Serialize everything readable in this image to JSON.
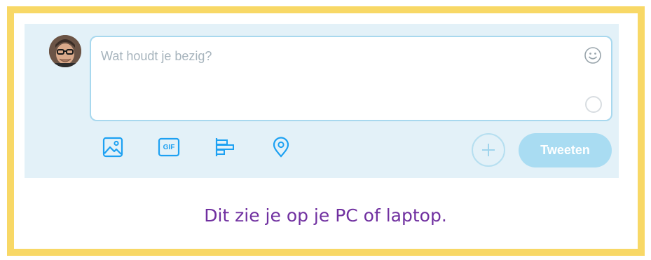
{
  "composer": {
    "placeholder": "Wat houdt je bezig?",
    "tweet_label": "Tweeten",
    "avatar_icon": "user-avatar",
    "emoji_icon": "smiley-icon",
    "counter_icon": "character-counter-ring",
    "toolbar": [
      {
        "icon": "image-icon"
      },
      {
        "icon": "gif-icon",
        "label": "GIF"
      },
      {
        "icon": "poll-icon"
      },
      {
        "icon": "location-icon"
      }
    ],
    "add_icon": "plus-icon"
  },
  "caption": "Dit zie je op je PC of laptop.",
  "colors": {
    "frame_border": "#f8d866",
    "composer_bg": "#e3f1f8",
    "accent": "#1da1f2",
    "tweet_button": "#a9dcf2",
    "caption": "#7030a0"
  }
}
